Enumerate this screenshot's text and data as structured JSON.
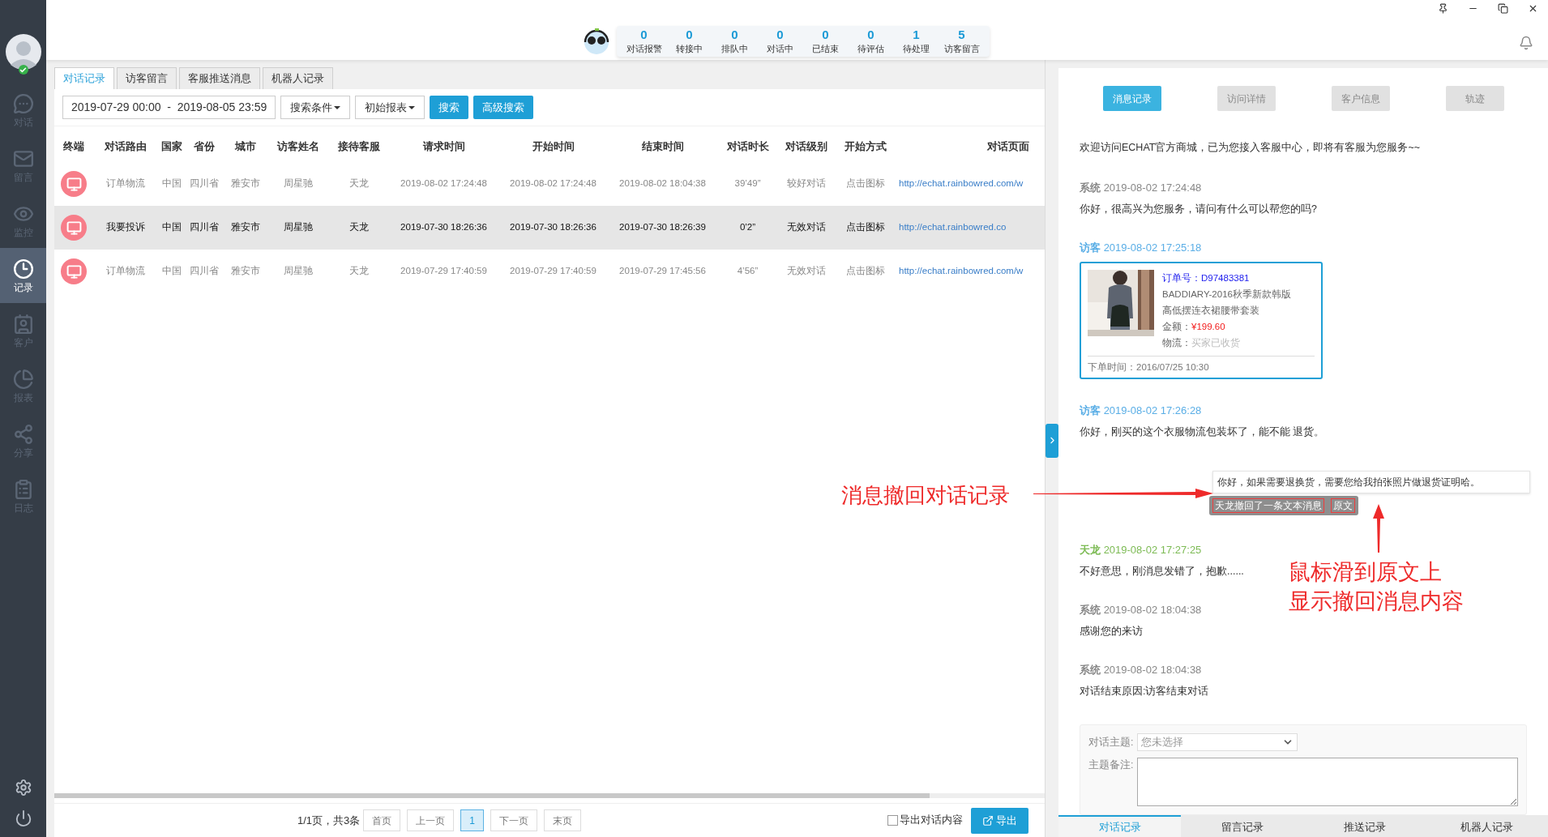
{
  "sidebar": {
    "items": [
      {
        "kind": "chat",
        "label": "对话",
        "selected": false
      },
      {
        "kind": "mail",
        "label": "留言",
        "selected": false
      },
      {
        "kind": "monitor",
        "label": "监控",
        "selected": false
      },
      {
        "kind": "record",
        "label": "记录",
        "selected": true
      },
      {
        "kind": "customer",
        "label": "客户",
        "selected": false
      },
      {
        "kind": "report",
        "label": "报表",
        "selected": false
      },
      {
        "kind": "share",
        "label": "分享",
        "selected": false
      },
      {
        "kind": "log",
        "label": "日志",
        "selected": false
      }
    ],
    "online": true
  },
  "stats": [
    {
      "count": "0",
      "label": "对话报警"
    },
    {
      "count": "0",
      "label": "转接中"
    },
    {
      "count": "0",
      "label": "排队中"
    },
    {
      "count": "0",
      "label": "对话中"
    },
    {
      "count": "0",
      "label": "已结束"
    },
    {
      "count": "0",
      "label": "待评估"
    },
    {
      "count": "1",
      "label": "待处理"
    },
    {
      "count": "5",
      "label": "访客留言"
    }
  ],
  "tabs": [
    {
      "label": "对话记录",
      "selected": true
    },
    {
      "label": "访客留言",
      "selected": false
    },
    {
      "label": "客服推送消息",
      "selected": false
    },
    {
      "label": "机器人记录",
      "selected": false
    }
  ],
  "toolbar": {
    "date_range": "2019-07-29 00:00  -  2019-08-05 23:59",
    "dropdowns": [
      "搜索条件",
      "初始报表"
    ],
    "buttons": [
      "搜索",
      "高级搜索"
    ]
  },
  "table": {
    "columns": [
      "终端",
      "对话路由",
      "国家",
      "省份",
      "城市",
      "访客姓名",
      "接待客服",
      "请求时间",
      "开始时间",
      "结束时间",
      "对话时长",
      "对话级别",
      "开始方式",
      "对话页面"
    ],
    "rows": [
      {
        "selected": false,
        "cells": [
          "",
          "订单物流",
          "中国",
          "四川省",
          "雅安市",
          "周星驰",
          "天龙",
          "2019-08-02 17:24:48",
          "2019-08-02 17:24:48",
          "2019-08-02 18:04:38",
          "39’49”",
          "较好对话",
          "点击图标",
          "http://echat.rainbowred.com/w"
        ]
      },
      {
        "selected": true,
        "cells": [
          "",
          "我要投诉",
          "中国",
          "四川省",
          "雅安市",
          "周星驰",
          "天龙",
          "2019-07-30 18:26:36",
          "2019-07-30 18:26:36",
          "2019-07-30 18:26:39",
          "0’2”",
          "无效对话",
          "点击图标",
          "http://echat.rainbowred.co"
        ]
      },
      {
        "selected": false,
        "cells": [
          "",
          "订单物流",
          "中国",
          "四川省",
          "雅安市",
          "周星驰",
          "天龙",
          "2019-07-29 17:40:59",
          "2019-07-29 17:40:59",
          "2019-07-29 17:45:56",
          "4’56”",
          "无效对话",
          "点击图标",
          "http://echat.rainbowred.com/w"
        ]
      }
    ]
  },
  "pagination": {
    "summary": "1/1页，共3条",
    "buttons": [
      {
        "label": "首页",
        "selected": false
      },
      {
        "label": "上一页",
        "selected": false
      },
      {
        "label": "1",
        "selected": true
      },
      {
        "label": "下一页",
        "selected": false
      },
      {
        "label": "末页",
        "selected": false
      }
    ],
    "export_option": {
      "label": "导出对话内容",
      "checked": false
    },
    "export_button": "导出"
  },
  "detail_tabs": [
    {
      "label": "消息记录",
      "selected": true
    },
    {
      "label": "访问详情",
      "selected": false
    },
    {
      "label": "客户信息",
      "selected": false
    },
    {
      "label": "轨迹",
      "selected": false
    }
  ],
  "messages": [
    {
      "kind": "notice",
      "text": "欢迎访问ECHAT官方商城，已为您接入客服中心，即将有客服为您服务~~"
    },
    {
      "kind": "system",
      "sender": "系统",
      "time": "2019-08-02 17:24:48",
      "text": "你好，很高兴为您服务，请问有什么可以帮您的吗?"
    },
    {
      "kind": "visitor",
      "sender": "访客",
      "time": "2019-08-02 17:25:18",
      "order": {
        "number_label": "订单号：",
        "number": "D97483381",
        "title_lines": [
          "BADDIARY-2016秋季新款韩版",
          "高低摆连衣裙腰带套装"
        ],
        "amount_label": "金额：",
        "amount": "¥199.60",
        "logistics_label": "物流：",
        "logistics": "买家已收货",
        "time": "下单时间：2016/07/25 10:30"
      }
    },
    {
      "kind": "visitor",
      "sender": "访客",
      "time": "2019-08-02 17:26:28",
      "text": "你好，刚买的这个衣服物流包装坏了，能不能 退货。"
    },
    {
      "kind": "recall",
      "text": "天龙撤回了一条文本消息",
      "link": "原文",
      "tooltip": "你好，如果需要退换货，需要您给我拍张照片做退货证明哈。"
    },
    {
      "kind": "agent",
      "sender": "天龙",
      "time": "2019-08-02 17:27:25",
      "text": "不好意思，刚消息发错了，抱歉......"
    },
    {
      "kind": "system",
      "sender": "系统",
      "time": "2019-08-02 18:04:38",
      "text": "感谢您的来访"
    },
    {
      "kind": "system",
      "sender": "系统",
      "time": "2019-08-02 18:04:38",
      "text": "对话结束原因:访客结束对话"
    }
  ],
  "topic_form": {
    "topic_label": "对话主题:",
    "topic_placeholder": "您未选择",
    "note_label": "主题备注:"
  },
  "bottom_tabs": [
    {
      "label": "对话记录",
      "selected": true
    },
    {
      "label": "留言记录",
      "selected": false
    },
    {
      "label": "推送记录",
      "selected": false
    },
    {
      "label": "机器人记录",
      "selected": false
    }
  ],
  "annotations": [
    {
      "kind": "left",
      "text": "消息撤回对话记录"
    },
    {
      "kind": "below",
      "lines": [
        "鼠标滑到原文上",
        "显示撤回消息内容"
      ]
    }
  ]
}
